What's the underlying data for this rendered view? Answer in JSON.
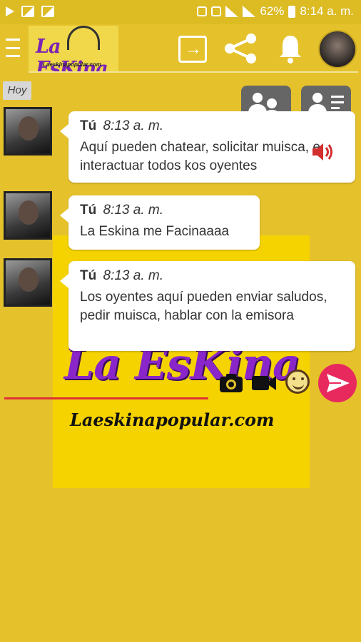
{
  "status_bar": {
    "battery": "62%",
    "time": "8:14 a. m."
  },
  "header": {
    "logo_text": "La EsKina",
    "logo_sub": "Laeskinapopular.com"
  },
  "background_logo": {
    "title": "La EsKina",
    "subtitle": "Laeskinapopular.com"
  },
  "chat": {
    "date_label": "Hoy",
    "messages": [
      {
        "sender": "Tú",
        "time": "8:13 a. m.",
        "text": "Aquí pueden chatear, solicitar muisca, e interactuar todos kos oyentes"
      },
      {
        "sender": "Tú",
        "time": "8:13 a. m.",
        "text": "La Eskina me Facinaaaa"
      },
      {
        "sender": "Tú",
        "time": "8:13 a. m.",
        "text": "Los oyentes aquí pueden enviar saludos, pedir muisca, hablar con la emisora"
      }
    ]
  },
  "colors": {
    "background": "#e5c22c",
    "send_button": "#e8295e",
    "action_button": "#666666",
    "input_underline": "#dd3333"
  }
}
